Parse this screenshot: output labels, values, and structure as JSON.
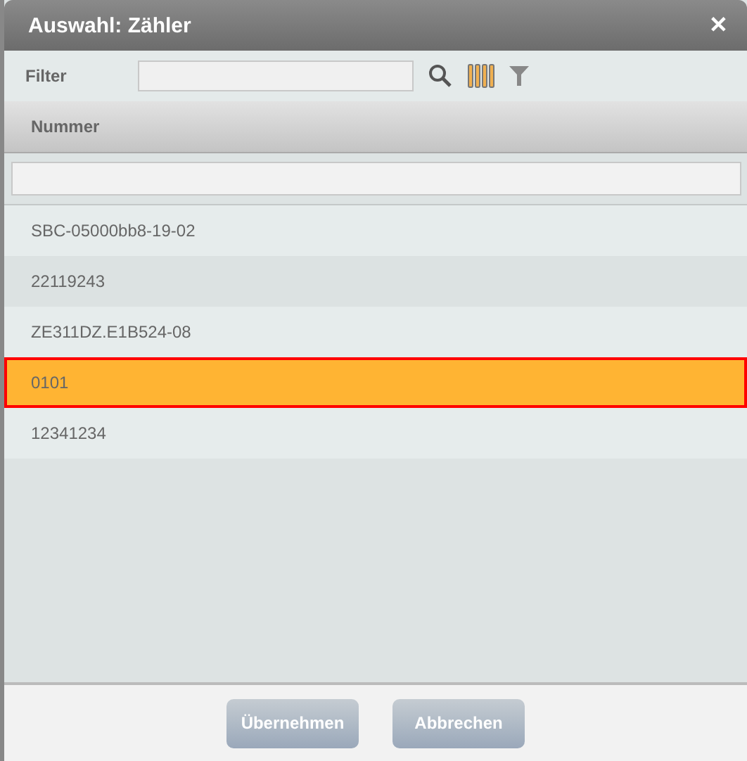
{
  "window": {
    "title": "Auswahl: Zähler",
    "close": "✕"
  },
  "toolbar": {
    "filter_label": "Filter"
  },
  "table": {
    "columns": [
      "Nummer"
    ],
    "rows": [
      {
        "cells": [
          "SBC-05000bb8-19-02"
        ],
        "selected": false
      },
      {
        "cells": [
          "22119243"
        ],
        "selected": false
      },
      {
        "cells": [
          "ZE311DZ.E1B524-08"
        ],
        "selected": false
      },
      {
        "cells": [
          "0101"
        ],
        "selected": true
      },
      {
        "cells": [
          "12341234"
        ],
        "selected": false
      }
    ]
  },
  "buttons": [
    "Übernehmen",
    "Abbrechen"
  ]
}
